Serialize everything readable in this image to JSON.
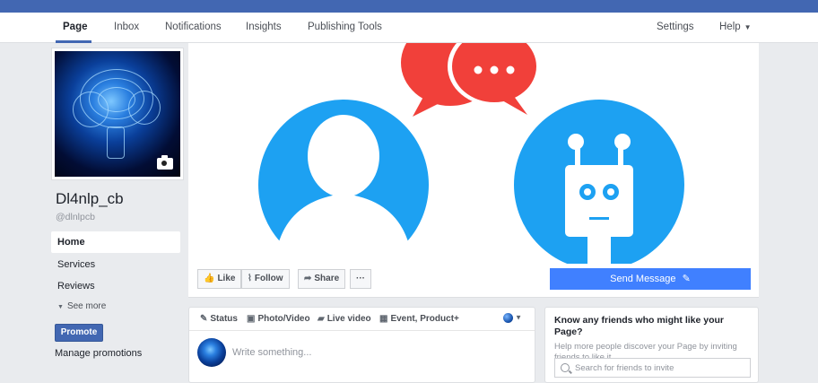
{
  "nav": {
    "tabs": [
      {
        "label": "Page"
      },
      {
        "label": "Inbox"
      },
      {
        "label": "Notifications"
      },
      {
        "label": "Insights"
      },
      {
        "label": "Publishing Tools"
      }
    ],
    "settings": "Settings",
    "help": "Help",
    "help_caret": "▼"
  },
  "profile": {
    "name": "Dl4nlp_cb",
    "handle": "@dlnlpcb"
  },
  "sidebar": {
    "items": [
      {
        "label": "Home"
      },
      {
        "label": "Services"
      },
      {
        "label": "Reviews"
      }
    ],
    "see_more": "See more",
    "see_more_caret": "▼",
    "promote": "Promote",
    "manage_promotions": "Manage promotions"
  },
  "actions": {
    "like": "Like",
    "follow": "Follow",
    "share": "Share",
    "more": "···",
    "send_message": "Send Message"
  },
  "composer": {
    "tabs": [
      {
        "label": "Status"
      },
      {
        "label": "Photo/Video"
      },
      {
        "label": "Live video"
      },
      {
        "label": "Event, Product+"
      }
    ],
    "audience_caret": "▼",
    "placeholder": "Write something..."
  },
  "friends_card": {
    "title": "Know any friends who might like your Page?",
    "description": "Help more people discover your Page by inviting friends to like it.",
    "search_placeholder": "Search for friends to invite"
  },
  "colors": {
    "brand_bar": "#4267b2",
    "send_button": "#4080ff",
    "cover_blue": "#1da1f2",
    "chat_red": "#f1403a"
  }
}
